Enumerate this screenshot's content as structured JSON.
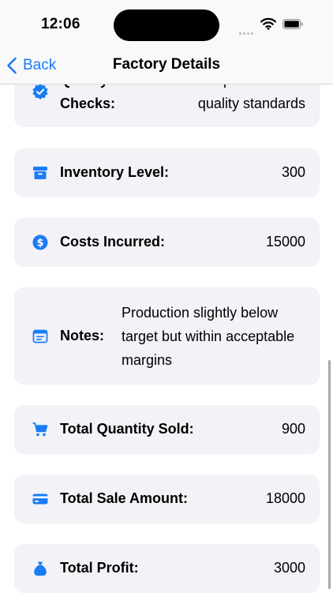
{
  "status_bar": {
    "time": "12:06"
  },
  "nav": {
    "back_label": "Back",
    "title": "Factory Details"
  },
  "rows": [
    {
      "label": "Quality Control Checks:",
      "value": "All products met quality standards",
      "icon": "checkmark-seal-icon"
    },
    {
      "label": "Inventory Level:",
      "value": "300",
      "icon": "archive-box-icon"
    },
    {
      "label": "Costs Incurred:",
      "value": "15000",
      "icon": "dollar-circle-icon"
    },
    {
      "label": "Notes:",
      "value": "Production slightly below target but within acceptable margins",
      "icon": "note-icon"
    },
    {
      "label": "Total Quantity Sold:",
      "value": "900",
      "icon": "cart-icon"
    },
    {
      "label": "Total Sale Amount:",
      "value": "18000",
      "icon": "credit-card-icon"
    },
    {
      "label": "Total Profit:",
      "value": "3000",
      "icon": "money-bag-icon"
    }
  ],
  "colors": {
    "accent": "#1a7cf5",
    "card": "#f2f2f7"
  }
}
